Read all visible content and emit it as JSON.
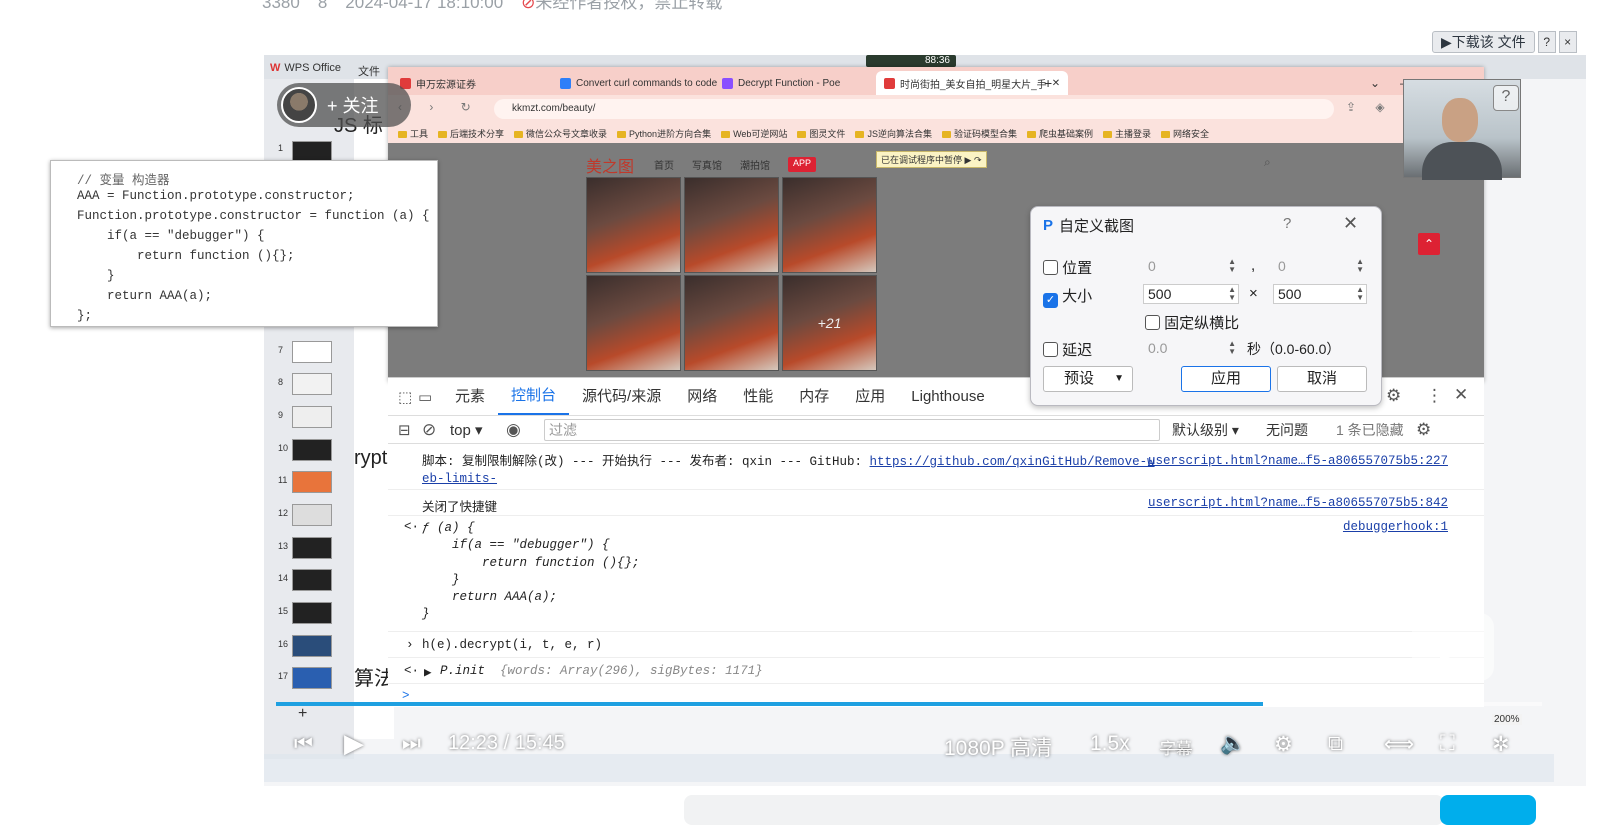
{
  "meta": {
    "plays": "3380",
    "comments": "8",
    "date": "2024-04-17 18:10:00",
    "copyright": "未经作者授权，禁止转载"
  },
  "download": {
    "label": "▶下载该 文件",
    "help": "?",
    "close": "×"
  },
  "wps": {
    "tab": "WPS Office",
    "file_menu": "文件",
    "timer": "88:36",
    "slide_text_1": "JS 标",
    "slide_text_2": "rypt",
    "slide_text_3": "算法",
    "add_slide": "+",
    "slide_numbers": [
      "1",
      "7",
      "8",
      "9",
      "10",
      "11",
      "12",
      "13",
      "14",
      "15",
      "16",
      "17"
    ]
  },
  "browser": {
    "tabs": [
      {
        "label": "申万宏源证券",
        "color": "#e03b3b"
      },
      {
        "label": "Convert curl commands to code",
        "color": "#2d7ff9"
      },
      {
        "label": "Decrypt Function - Poe",
        "color": "#8a4fff"
      },
      {
        "label": "时尚街拍_美女自拍_明星大片_手",
        "color": "#e03b3b"
      }
    ],
    "url": "kkmzt.com/beauty/",
    "bookmarks": [
      "工具",
      "后端技术分享",
      "微信公众号文章收录",
      "Python进阶方向合集",
      "Web可逆网站",
      "图灵文件",
      "JS逆向算法合集",
      "验证码模型合集",
      "爬虫基础案例",
      "主播登录",
      "网络安全"
    ],
    "site": {
      "logo": "美之图",
      "nav": [
        "首页",
        "写真馆",
        "潮拍馆"
      ],
      "app": "APP",
      "paused": "已在调试程序中暂停",
      "more_photos": "+21"
    }
  },
  "devtools": {
    "tabs": [
      "元素",
      "控制台",
      "源代码/来源",
      "网络",
      "性能",
      "内存",
      "应用",
      "Lighthouse"
    ],
    "active_tab": "控制台",
    "context": "top",
    "filter_placeholder": "过滤",
    "level": "默认级别",
    "issues": "无问题",
    "hidden": "1 条已隐藏",
    "console": {
      "line1_text": "脚本: 复制限制解除(改) --- 开始执行 --- 发布者: qxin --- GitHub: ",
      "line1_link": "https://github.com/qxinGitHub/Remove-w",
      "line1_link2": "eb-limits-",
      "line1_src": "userscript.html?name…f5-a806557075b5:227",
      "line2_text": "关闭了快捷键",
      "line2_src": "userscript.html?name…f5-a806557075b5:842",
      "fn_src": "debuggerhook:1",
      "fn_lines": [
        "ƒ (a) {",
        "    if(a == \"debugger\") {",
        "        return function (){};",
        "    }",
        "    return AAA(a);",
        "}"
      ],
      "call": "h(e).decrypt(i, t, e, r)",
      "result_name": "P.init",
      "result_body": "{words: Array(296), sigBytes: 1171}",
      "prompt": ">"
    }
  },
  "screenshot_dialog": {
    "title": "自定义截图",
    "help": "?",
    "position_label": "位置",
    "pos_x": "0",
    "pos_y": "0",
    "comma": ",",
    "size_label": "大小",
    "width": "500",
    "height": "500",
    "times": "×",
    "keep_ratio": "固定纵横比",
    "delay_label": "延迟",
    "delay": "0.0",
    "delay_unit": "秒（0.0-60.0）",
    "preset": "预设",
    "apply": "应用",
    "cancel": "取消"
  },
  "code_card": {
    "lines": [
      "// 变量 构造器",
      "AAA = Function.prototype.constructor;",
      "Function.prototype.constructor = function (a) {",
      "    if(a == \"debugger\") {",
      "        return function (){};",
      "    }",
      "    return AAA(a);",
      "};"
    ]
  },
  "follow": {
    "label": "+ 关注"
  },
  "player": {
    "current_time": "12:23",
    "separator": "/",
    "duration": "15:45",
    "quality": "1080P 高清",
    "speed": "1.5x",
    "subtitle": "字幕",
    "zoom": "200%",
    "progress": 0.78
  },
  "colors": {
    "accent": "#1a73e8",
    "progress": "#1ea0e1",
    "brand_red": "#c0392b"
  }
}
